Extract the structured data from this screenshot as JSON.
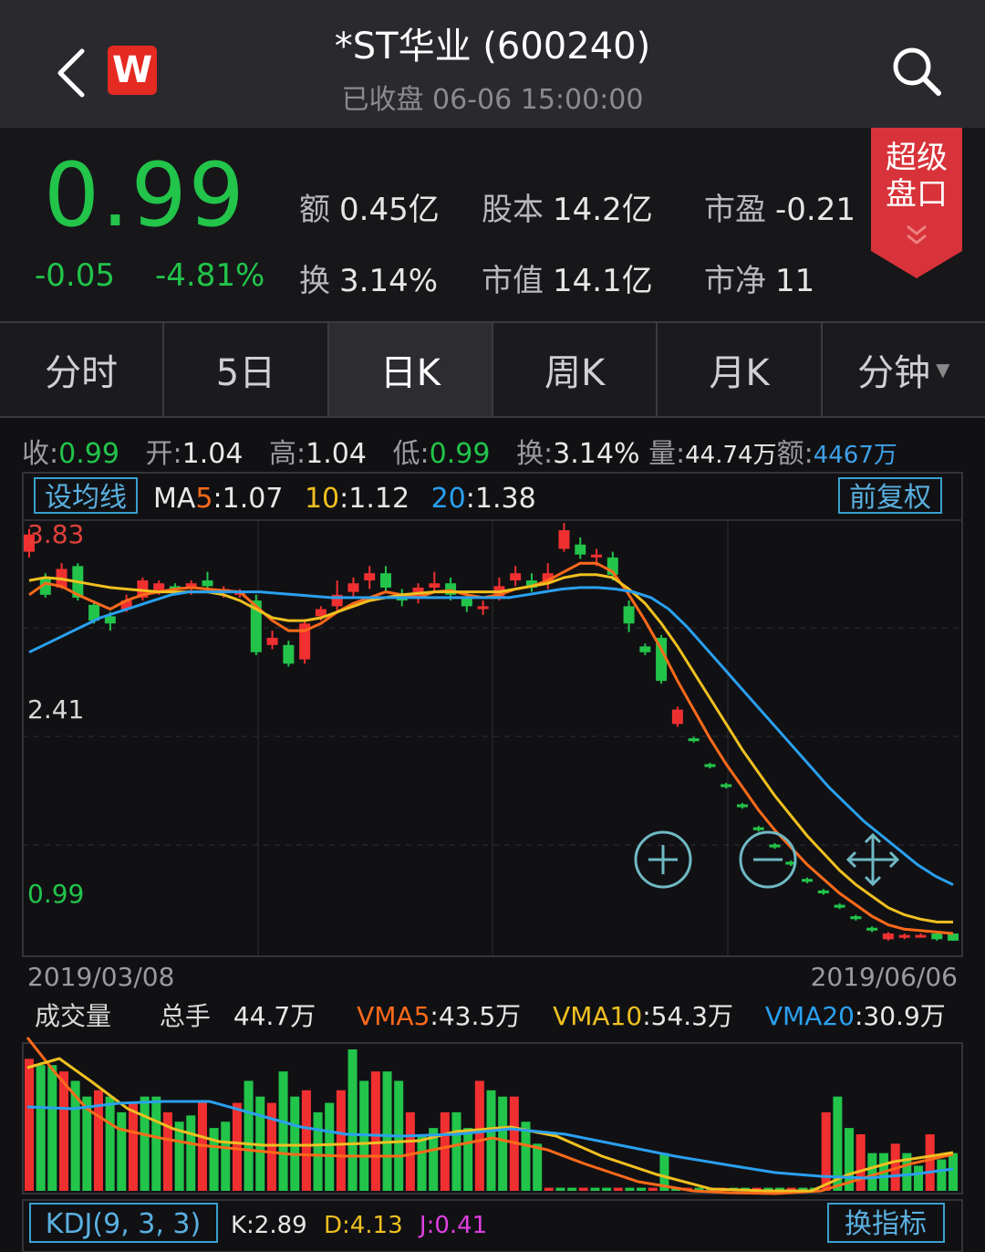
{
  "header": {
    "title": "*ST华业 (600240)",
    "subtitle": "已收盘 06-06 15:00:00",
    "logo_text": "W"
  },
  "quote": {
    "price": "0.99",
    "change": "-0.05",
    "change_pct": "-4.81%",
    "color_down": "#22c44a"
  },
  "stats": [
    {
      "key": "额",
      "value": "0.45亿"
    },
    {
      "key": "股本",
      "value": "14.2亿"
    },
    {
      "key": "市盈",
      "value": "-0.21"
    },
    {
      "key": "换",
      "value": "3.14%"
    },
    {
      "key": "市值",
      "value": "14.1亿"
    },
    {
      "key": "市净",
      "value": "11"
    }
  ],
  "super_button": {
    "line1": "超级",
    "line2": "盘口"
  },
  "tabs": [
    {
      "label": "分时"
    },
    {
      "label": "5日"
    },
    {
      "label": "日K"
    },
    {
      "label": "周K"
    },
    {
      "label": "月K"
    },
    {
      "label": "分钟"
    }
  ],
  "ohlc": {
    "close_k": "收:",
    "close": "0.99",
    "open_k": "开:",
    "open": "1.04",
    "high_k": "高:",
    "high": "1.04",
    "low_k": "低:",
    "low": "0.99",
    "turn_k": "换:",
    "turn": "3.14%",
    "vol_k": "量:",
    "vol": "44.74万",
    "amt_k": "额:",
    "amt": "4467万"
  },
  "ma_bar": {
    "set_btn": "设均线",
    "ma5_k": "MA",
    "ma5_n": "5",
    "ma5": ":1.07",
    "ma10_n": "10",
    "ma10": ":1.12",
    "ma20_n": "20",
    "ma20": ":1.38",
    "adjust_btn": "前复权"
  },
  "axis": {
    "hi": "3.83",
    "mid": "2.41",
    "lo": "0.99",
    "date_start": "2019/03/08",
    "date_end": "2019/06/06"
  },
  "volume_bar": {
    "title": "成交量",
    "hands_k": "总手",
    "hands": "44.7万",
    "vma5_k": "VMA5",
    "vma5": ":43.5万",
    "vma10_k": "VMA10",
    "vma10": ":54.3万",
    "vma20_k": "VMA20",
    "vma20": ":30.9万"
  },
  "kdj": {
    "btn": "KDJ(9, 3, 3)",
    "k": "K:2.89",
    "d": "D:4.13",
    "j": "J:0.41",
    "switch_btn": "换指标"
  },
  "colors": {
    "up": "#f03030",
    "down": "#22c44a",
    "ma5": "#ff6a1a",
    "ma10": "#f0c020",
    "ma20": "#2aa0f0"
  },
  "chart_data": {
    "type": "candlestick",
    "x_range": [
      "2019/03/08",
      "2019/06/06"
    ],
    "y_labels": [
      "3.83",
      "2.41",
      "0.99"
    ],
    "candles": [
      [
        3.7,
        3.82,
        3.86,
        3.66
      ],
      [
        3.52,
        3.4,
        3.55,
        3.38
      ],
      [
        3.45,
        3.58,
        3.62,
        3.44
      ],
      [
        3.6,
        3.38,
        3.62,
        3.36
      ],
      [
        3.33,
        3.22,
        3.36,
        3.2
      ],
      [
        3.25,
        3.2,
        3.28,
        3.15
      ],
      [
        3.3,
        3.36,
        3.4,
        3.28
      ],
      [
        3.38,
        3.5,
        3.52,
        3.36
      ],
      [
        3.42,
        3.48,
        3.5,
        3.4
      ],
      [
        3.46,
        3.44,
        3.48,
        3.42
      ],
      [
        3.44,
        3.48,
        3.5,
        3.4
      ],
      [
        3.5,
        3.46,
        3.56,
        3.42
      ],
      [
        3.42,
        3.44,
        3.46,
        3.38
      ],
      [
        3.4,
        3.42,
        3.44,
        3.38
      ],
      [
        3.36,
        3.0,
        3.4,
        2.98
      ],
      [
        3.05,
        3.1,
        3.15,
        3.02
      ],
      [
        3.05,
        2.92,
        3.08,
        2.9
      ],
      [
        2.95,
        3.2,
        3.22,
        2.92
      ],
      [
        3.25,
        3.3,
        3.32,
        3.22
      ],
      [
        3.32,
        3.4,
        3.5,
        3.28
      ],
      [
        3.42,
        3.48,
        3.52,
        3.38
      ],
      [
        3.5,
        3.55,
        3.6,
        3.44
      ],
      [
        3.55,
        3.45,
        3.6,
        3.42
      ],
      [
        3.4,
        3.36,
        3.44,
        3.32
      ],
      [
        3.38,
        3.45,
        3.48,
        3.34
      ],
      [
        3.45,
        3.48,
        3.56,
        3.42
      ],
      [
        3.48,
        3.4,
        3.52,
        3.36
      ],
      [
        3.38,
        3.32,
        3.42,
        3.28
      ],
      [
        3.3,
        3.32,
        3.36,
        3.26
      ],
      [
        3.38,
        3.46,
        3.52,
        3.36
      ],
      [
        3.5,
        3.55,
        3.6,
        3.46
      ],
      [
        3.5,
        3.45,
        3.55,
        3.42
      ],
      [
        3.48,
        3.55,
        3.62,
        3.44
      ],
      [
        3.72,
        3.85,
        3.9,
        3.7
      ],
      [
        3.75,
        3.68,
        3.8,
        3.65
      ],
      [
        3.66,
        3.68,
        3.72,
        3.6
      ],
      [
        3.66,
        3.54,
        3.7,
        3.5
      ],
      [
        3.32,
        3.2,
        3.36,
        3.14
      ],
      [
        3.04,
        3.0,
        3.06,
        2.98
      ],
      [
        3.1,
        2.8,
        3.12,
        2.78
      ],
      [
        2.5,
        2.6,
        2.62,
        2.48
      ],
      [
        2.4,
        2.38,
        2.41,
        2.37
      ],
      [
        2.22,
        2.2,
        2.23,
        2.19
      ],
      [
        2.08,
        2.06,
        2.09,
        2.05
      ],
      [
        1.94,
        1.92,
        1.95,
        1.91
      ],
      [
        1.78,
        1.76,
        1.79,
        1.75
      ],
      [
        1.66,
        1.64,
        1.67,
        1.63
      ],
      [
        1.54,
        1.52,
        1.55,
        1.51
      ],
      [
        1.42,
        1.4,
        1.43,
        1.39
      ],
      [
        1.34,
        1.32,
        1.35,
        1.31
      ],
      [
        1.24,
        1.22,
        1.25,
        1.21
      ],
      [
        1.16,
        1.14,
        1.17,
        1.13
      ],
      [
        1.08,
        1.06,
        1.09,
        1.05
      ],
      [
        1.0,
        1.04,
        1.05,
        0.99
      ],
      [
        1.01,
        1.03,
        1.04,
        1.0
      ],
      [
        1.02,
        1.03,
        1.04,
        1.01
      ],
      [
        1.04,
        1.0,
        1.05,
        0.99
      ],
      [
        1.04,
        0.99,
        1.04,
        0.99
      ]
    ],
    "ma5": [
      3.4,
      3.48,
      3.46,
      3.4,
      3.35,
      3.3,
      3.36,
      3.4,
      3.42,
      3.44,
      3.45,
      3.44,
      3.43,
      3.42,
      3.32,
      3.22,
      3.15,
      3.15,
      3.2,
      3.28,
      3.34,
      3.38,
      3.42,
      3.4,
      3.38,
      3.42,
      3.43,
      3.4,
      3.38,
      3.4,
      3.44,
      3.46,
      3.5,
      3.56,
      3.62,
      3.62,
      3.56,
      3.4,
      3.22,
      3.02,
      2.8,
      2.6,
      2.4,
      2.22,
      2.06,
      1.9,
      1.76,
      1.64,
      1.52,
      1.42,
      1.32,
      1.24,
      1.16,
      1.1,
      1.07,
      1.06,
      1.05,
      1.04
    ],
    "ma10": [
      3.5,
      3.52,
      3.51,
      3.49,
      3.47,
      3.45,
      3.44,
      3.43,
      3.42,
      3.42,
      3.42,
      3.42,
      3.4,
      3.36,
      3.3,
      3.24,
      3.22,
      3.22,
      3.24,
      3.28,
      3.32,
      3.36,
      3.38,
      3.4,
      3.41,
      3.42,
      3.42,
      3.42,
      3.42,
      3.42,
      3.44,
      3.46,
      3.48,
      3.52,
      3.54,
      3.54,
      3.52,
      3.44,
      3.34,
      3.2,
      3.04,
      2.86,
      2.68,
      2.5,
      2.32,
      2.16,
      2.0,
      1.86,
      1.72,
      1.6,
      1.48,
      1.38,
      1.3,
      1.22,
      1.17,
      1.14,
      1.12,
      1.12
    ],
    "ma20": [
      3.0,
      3.06,
      3.12,
      3.18,
      3.24,
      3.28,
      3.32,
      3.36,
      3.4,
      3.42,
      3.42,
      3.42,
      3.42,
      3.42,
      3.41,
      3.4,
      3.39,
      3.38,
      3.38,
      3.38,
      3.38,
      3.38,
      3.38,
      3.38,
      3.38,
      3.38,
      3.38,
      3.38,
      3.4,
      3.42,
      3.44,
      3.45,
      3.45,
      3.44,
      3.42,
      3.38,
      3.3,
      3.18,
      3.04,
      2.9,
      2.76,
      2.62,
      2.48,
      2.34,
      2.2,
      2.06,
      1.94,
      1.82,
      1.72,
      1.62,
      1.52,
      1.44,
      1.38
    ],
    "volume": [
      42,
      40,
      40,
      38,
      35,
      30,
      32,
      30,
      25,
      28,
      30,
      30,
      25,
      22,
      24,
      28,
      20,
      22,
      28,
      35,
      30,
      28,
      38,
      30,
      32,
      25,
      28,
      32,
      45,
      35,
      38,
      38,
      35,
      25,
      18,
      20,
      25,
      25,
      20,
      35,
      32,
      30,
      30,
      22,
      15,
      1,
      1,
      1,
      1,
      1,
      1,
      1,
      1,
      1,
      1,
      12,
      1,
      1,
      1,
      1,
      1,
      1,
      1,
      1,
      1,
      1,
      1,
      1,
      1,
      25,
      30,
      20,
      18,
      12,
      12,
      15,
      12,
      8,
      18,
      10,
      12
    ]
  }
}
